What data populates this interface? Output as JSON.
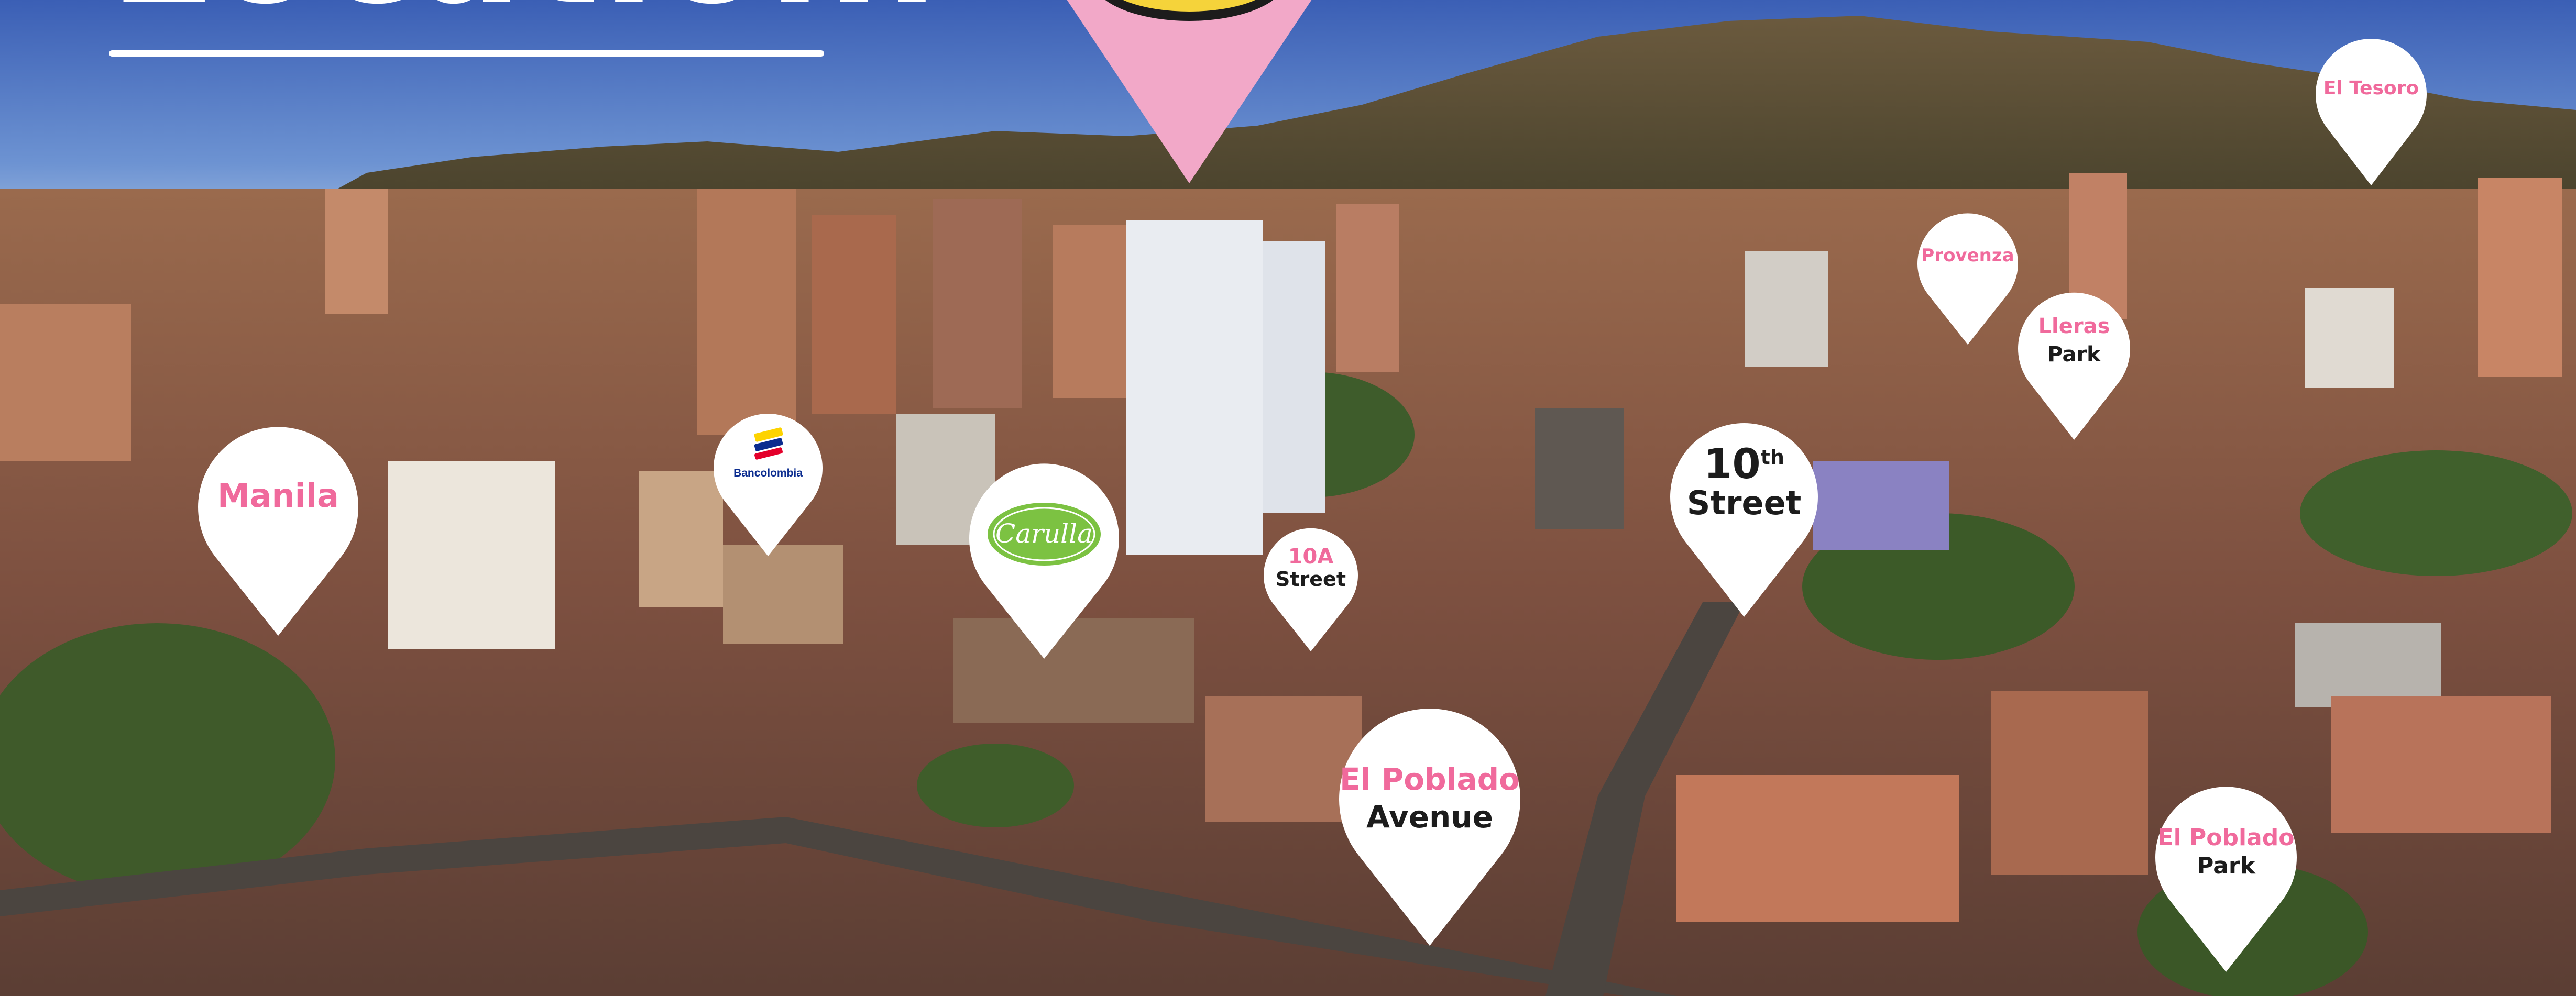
{
  "headline": {
    "text": "Location."
  },
  "colors": {
    "sky_top": "#3e62b8",
    "sky_bottom": "#a9c3e6",
    "pin_fill": "#ffffff",
    "pin_text_pink": "#f06a9c",
    "pin_text_dark": "#1c1c1c",
    "top_marker_pink": "#f2a8c8",
    "top_marker_yellow": "#f5d33a",
    "carulla_green": "#7cc242",
    "bancolombia_yellow": "#fdd300",
    "bancolombia_blue": "#0b2c8f",
    "bancolombia_red": "#e4002b"
  },
  "pins": {
    "manila": {
      "line1": "Manila"
    },
    "bancolombia": {
      "logo_text": "Bancolombia",
      "icon": "bancolombia-logo"
    },
    "carulla": {
      "logo_text": "Carulla",
      "icon": "carulla-logo"
    },
    "street_10a": {
      "line1": "10A",
      "line2": "Street"
    },
    "street_10th": {
      "line1": "10",
      "sup": "th",
      "line2": "Street"
    },
    "provenza": {
      "line1": "Provenza"
    },
    "lleras_park": {
      "line1": "Lleras",
      "line2": "Park"
    },
    "el_tesoro": {
      "line1": "El Tesoro"
    },
    "el_poblado_avenue": {
      "line1": "El Poblado",
      "line2": "Avenue"
    },
    "el_poblado_park": {
      "line1": "El Poblado",
      "line2": "Park"
    }
  }
}
